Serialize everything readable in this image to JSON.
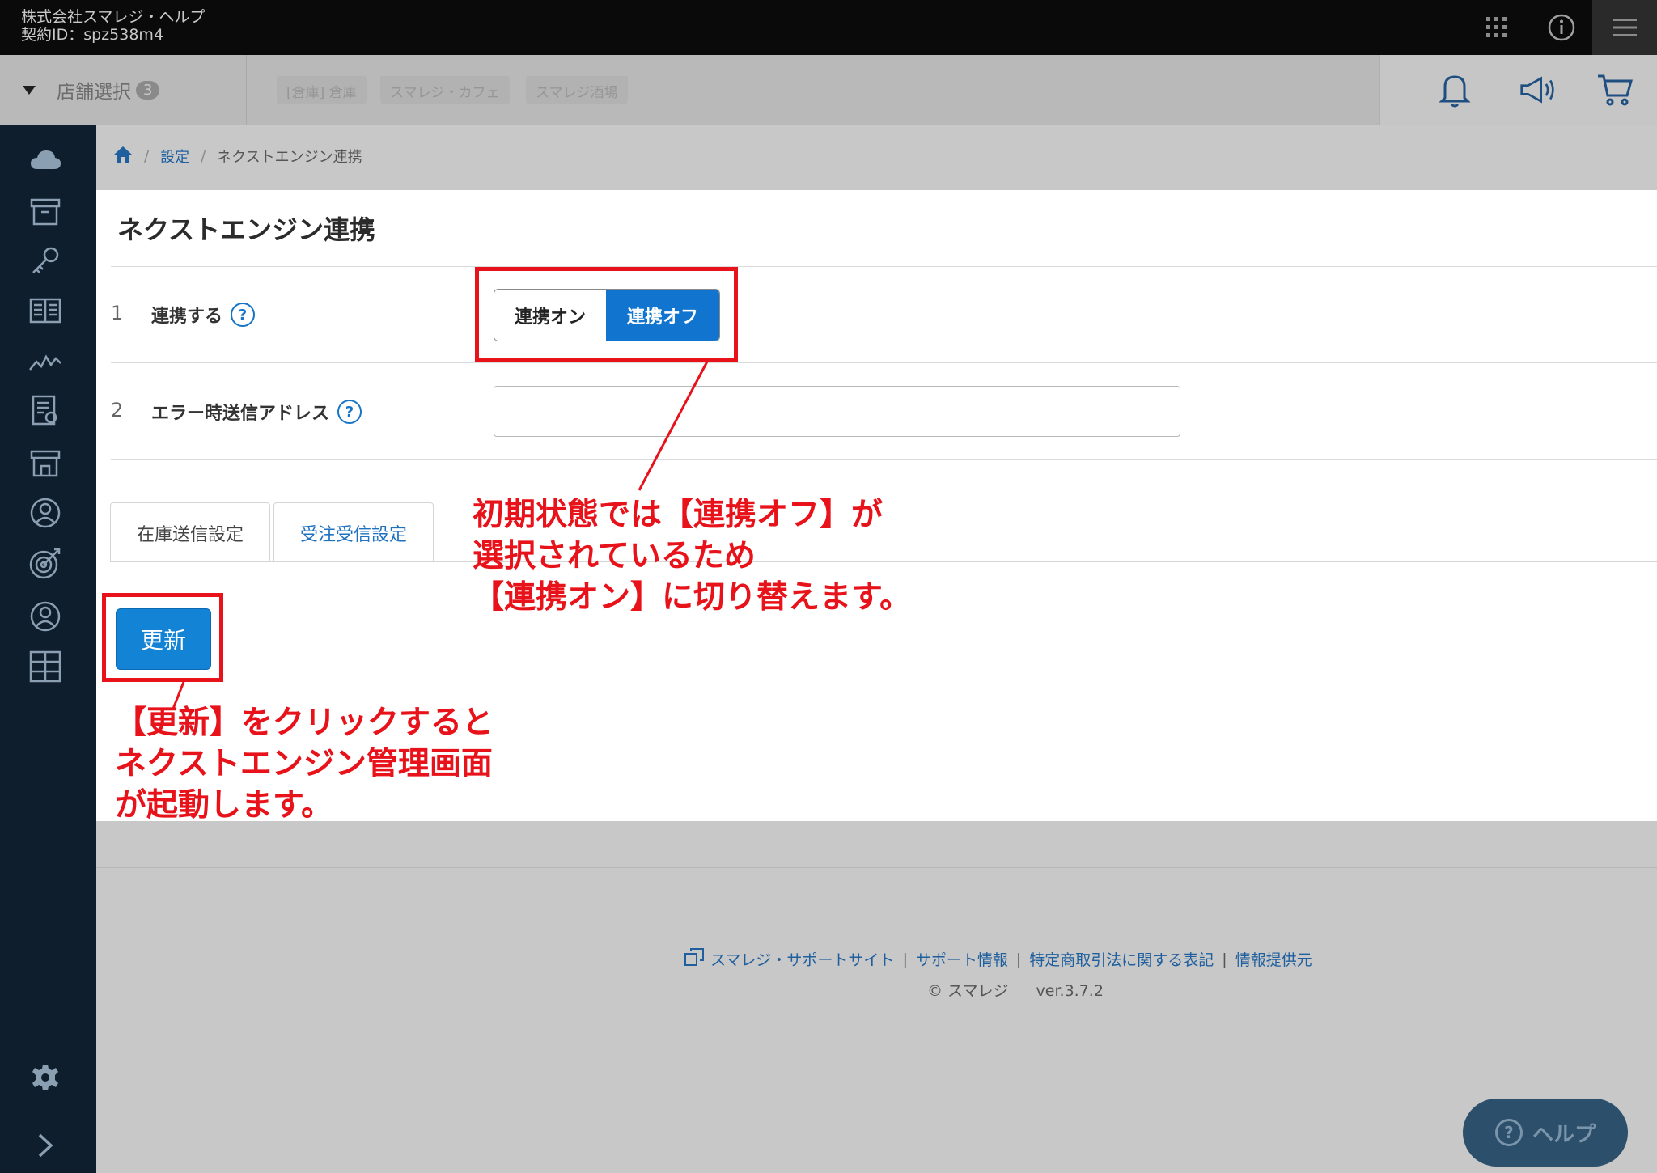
{
  "topbar": {
    "company": "株式会社スマレジ・ヘルプ",
    "contract": "契約ID：spz538m4",
    "icons": [
      "apps-grid-icon",
      "info-icon",
      "hamburger-menu-icon"
    ]
  },
  "storebar": {
    "label": "店舗選択",
    "count": "3",
    "stores": [
      "[倉庫] 倉庫",
      "スマレジ・カフェ",
      "スマレジ酒場"
    ],
    "icons": [
      "bell-icon",
      "megaphone-icon",
      "cart-icon"
    ]
  },
  "sidebar": {
    "icons": [
      "cloud-icon",
      "archive-box-icon",
      "key-icon",
      "book-icon",
      "chart-icon",
      "report-icon",
      "store-icon",
      "user-icon",
      "target-icon",
      "user-circle-icon",
      "grid-icon",
      "gear-icon",
      "chevron-right-icon"
    ]
  },
  "breadcrumb": {
    "settings": "設定",
    "current": "ネクストエンジン連携",
    "sep": "/"
  },
  "page": {
    "title": "ネクストエンジン連携",
    "rows": [
      {
        "num": "1",
        "label": "連携する",
        "help": "?"
      },
      {
        "num": "2",
        "label": "エラー時送信アドレス",
        "help": "?"
      }
    ],
    "toggle": {
      "on": "連携オン",
      "off": "連携オフ",
      "selected": "連携オフ"
    },
    "email": {
      "value": "",
      "placeholder": ""
    },
    "tabs": [
      "在庫送信設定",
      "受注受信設定"
    ],
    "update_button": "更新"
  },
  "annotations": {
    "toggle_note": [
      "初期状態では【連携オフ】が",
      "選択されているため",
      "【連携オン】に切り替えます。"
    ],
    "update_note": [
      "【更新】をクリックすると",
      "ネクストエンジン管理画面",
      "が起動します。"
    ],
    "color": "#e8121a"
  },
  "footer": {
    "links": [
      "スマレジ・サポートサイト",
      "サポート情報",
      "特定商取引法に関する表記",
      "情報提供元"
    ],
    "pipe": "|",
    "copyright": "© スマレジ",
    "version": "ver.3.7.2",
    "help_button": "ヘルプ",
    "help_q": "?"
  },
  "colors": {
    "accent": "#1175cf",
    "sidebar": "#0f1e2d",
    "topbar": "#0a0a0a"
  }
}
